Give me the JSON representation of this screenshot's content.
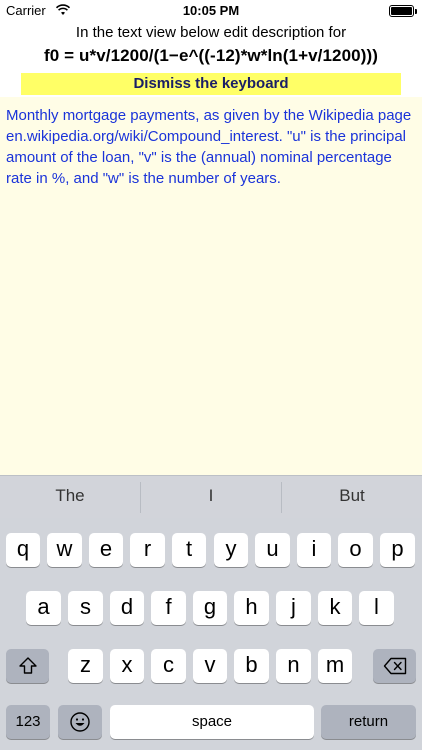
{
  "status_bar": {
    "carrier": "Carrier",
    "time": "10:05 PM"
  },
  "instruction": "In the text view below edit description for",
  "formula": "f0 = u*v/1200/(1−e^((-12)*w*ln(1+v/1200)))",
  "dismiss_button": "Dismiss the keyboard",
  "description": "Monthly mortgage payments, as given by the Wikipedia page en.wikipedia.org/wiki/Compound_interest. \"u\" is the principal amount of the loan, \"v\" is the (annual) nominal percentage rate in %, and \"w\" is the number of years.",
  "keyboard": {
    "predictions": [
      "The",
      "I",
      "But"
    ],
    "row1": [
      "q",
      "w",
      "e",
      "r",
      "t",
      "y",
      "u",
      "i",
      "o",
      "p"
    ],
    "row2": [
      "a",
      "s",
      "d",
      "f",
      "g",
      "h",
      "j",
      "k",
      "l"
    ],
    "row3": [
      "z",
      "x",
      "c",
      "v",
      "b",
      "n",
      "m"
    ],
    "numbers_key": "123",
    "space_key": "space",
    "return_key": "return",
    "shift_icon": "shift-icon",
    "emoji_icon": "emoji-icon",
    "backspace_icon": "backspace-icon"
  },
  "colors": {
    "dismiss_bg": "#ffff66",
    "text_bg": "#fffde6",
    "text_color": "#1a33d9"
  }
}
